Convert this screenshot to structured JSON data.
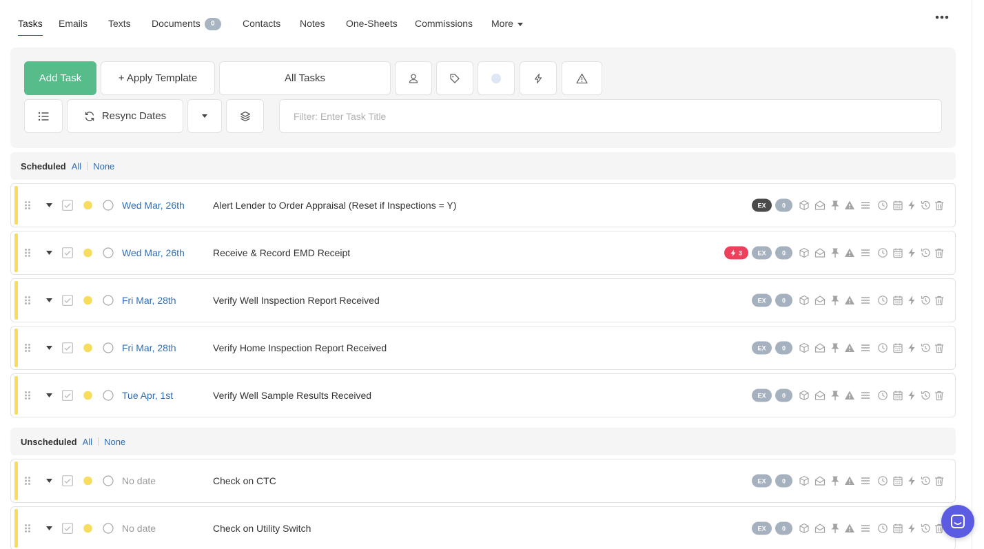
{
  "tabs": [
    {
      "label": "Tasks",
      "active": true
    },
    {
      "label": "Emails"
    },
    {
      "label": "Texts"
    },
    {
      "label": "Documents",
      "badge": "0"
    },
    {
      "label": "Contacts"
    },
    {
      "label": "Notes"
    },
    {
      "label": "One-Sheets"
    },
    {
      "label": "Commissions"
    },
    {
      "label": "More",
      "dropdown": true
    }
  ],
  "toolbar": {
    "add_task": "Add Task",
    "apply_template": "+ Apply Template",
    "all_tasks": "All Tasks",
    "resync_dates": "Resync Dates",
    "filter_placeholder": "Filter: Enter Task Title",
    "filter_value": ""
  },
  "sections": {
    "scheduled": {
      "title": "Scheduled",
      "all": "All",
      "none": "None"
    },
    "unscheduled": {
      "title": "Unscheduled",
      "all": "All",
      "none": "None"
    }
  },
  "tasks": [
    {
      "date": "Wed Mar, 26th",
      "title": "Alert Lender to Order Appraisal (Reset if Inspections = Y)",
      "ex": "EX",
      "ex_dark": true,
      "count": "0"
    },
    {
      "date": "Wed Mar, 26th",
      "title": "Receive & Record EMD Receipt",
      "ex": "EX",
      "count": "0",
      "flash": "3"
    },
    {
      "date": "Fri Mar, 28th",
      "title": "Verify Well Inspection Report Received",
      "ex": "EX",
      "count": "0"
    },
    {
      "date": "Fri Mar, 28th",
      "title": "Verify Home Inspection Report Received",
      "ex": "EX",
      "count": "0"
    },
    {
      "date": "Tue Apr, 1st",
      "title": "Verify Well Sample Results Received",
      "ex": "EX",
      "count": "0"
    },
    {
      "date": "No date",
      "title": "Check on CTC",
      "ex": "EX",
      "count": "0",
      "no_date": true
    },
    {
      "date": "No date",
      "title": "Check on Utility Switch",
      "ex": "EX",
      "count": "0",
      "no_date": true
    }
  ],
  "colors": {
    "accent_green": "#55bc8a",
    "link_blue": "#2e6db4",
    "status_yellow": "#f7dd5d",
    "alert_red": "#ee3f5c",
    "chat_purple": "#5b5ce2"
  },
  "row_icons": [
    "cube-icon",
    "envelope-open-icon",
    "pin-icon",
    "warning-icon",
    "lines-icon",
    "clock-icon",
    "calendar-icon",
    "bolt-icon",
    "history-icon",
    "trash-icon"
  ]
}
